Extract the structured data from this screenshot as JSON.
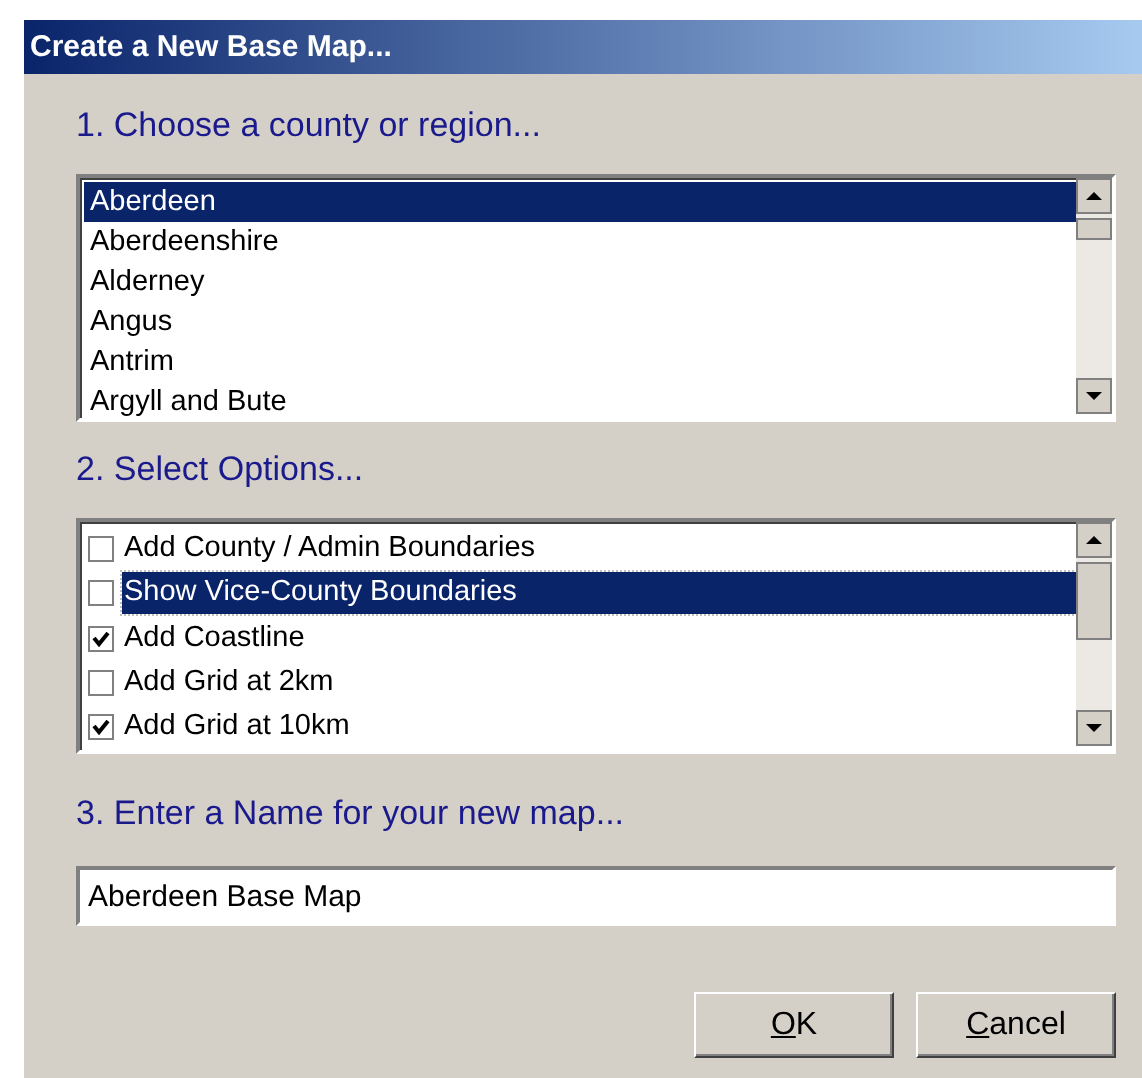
{
  "window": {
    "title": "Create a New Base Map..."
  },
  "region_section": {
    "label": "1. Choose a county or region...",
    "items": [
      {
        "label": "Aberdeen",
        "selected": true
      },
      {
        "label": "Aberdeenshire",
        "selected": false
      },
      {
        "label": "Alderney",
        "selected": false
      },
      {
        "label": "Angus",
        "selected": false
      },
      {
        "label": "Antrim",
        "selected": false
      },
      {
        "label": "Argyll and Bute",
        "selected": false
      }
    ]
  },
  "options_section": {
    "label": "2. Select Options...",
    "items": [
      {
        "label": "Add County / Admin Boundaries",
        "checked": false,
        "selected": false
      },
      {
        "label": "Show Vice-County Boundaries",
        "checked": false,
        "selected": true
      },
      {
        "label": "Add Coastline",
        "checked": true,
        "selected": false
      },
      {
        "label": "Add Grid at 2km",
        "checked": false,
        "selected": false
      },
      {
        "label": "Add Grid at 10km",
        "checked": true,
        "selected": false
      }
    ]
  },
  "name_section": {
    "label": "3. Enter a Name for your new map...",
    "value": "Aberdeen Base Map"
  },
  "buttons": [
    "OK",
    "Cancel"
  ]
}
